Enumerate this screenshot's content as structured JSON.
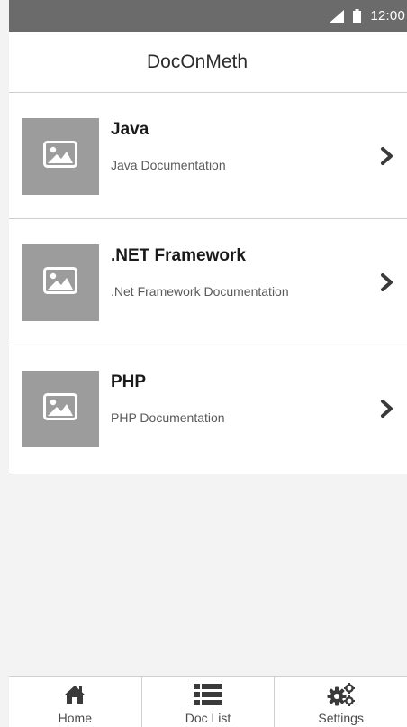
{
  "status_bar": {
    "time": "12:00",
    "signal_icon": "cellular-signal-icon",
    "battery_icon": "battery-icon"
  },
  "header": {
    "title": "DocOnMeth"
  },
  "doc_list": {
    "items": [
      {
        "title": "Java",
        "subtitle": "Java Documentation",
        "thumb_icon": "image-placeholder-icon",
        "action_icon": "chevron-right-icon"
      },
      {
        "title": ".NET Framework",
        "subtitle": ".Net Framework Documentation",
        "thumb_icon": "image-placeholder-icon",
        "action_icon": "chevron-right-icon"
      },
      {
        "title": "PHP",
        "subtitle": "PHP Documentation",
        "thumb_icon": "image-placeholder-icon",
        "action_icon": "chevron-right-icon"
      }
    ]
  },
  "tab_bar": {
    "tabs": [
      {
        "label": "Home",
        "icon": "home-icon"
      },
      {
        "label": "Doc List",
        "icon": "list-icon"
      },
      {
        "label": "Settings",
        "icon": "gears-icon"
      }
    ]
  },
  "colors": {
    "status_bar_bg": "#6b6b6b",
    "thumbnail_bg": "#9c9c9c",
    "page_bg": "#f3f3f3",
    "divider": "#cfcfcf",
    "icon_dark": "#3a3a3a"
  }
}
